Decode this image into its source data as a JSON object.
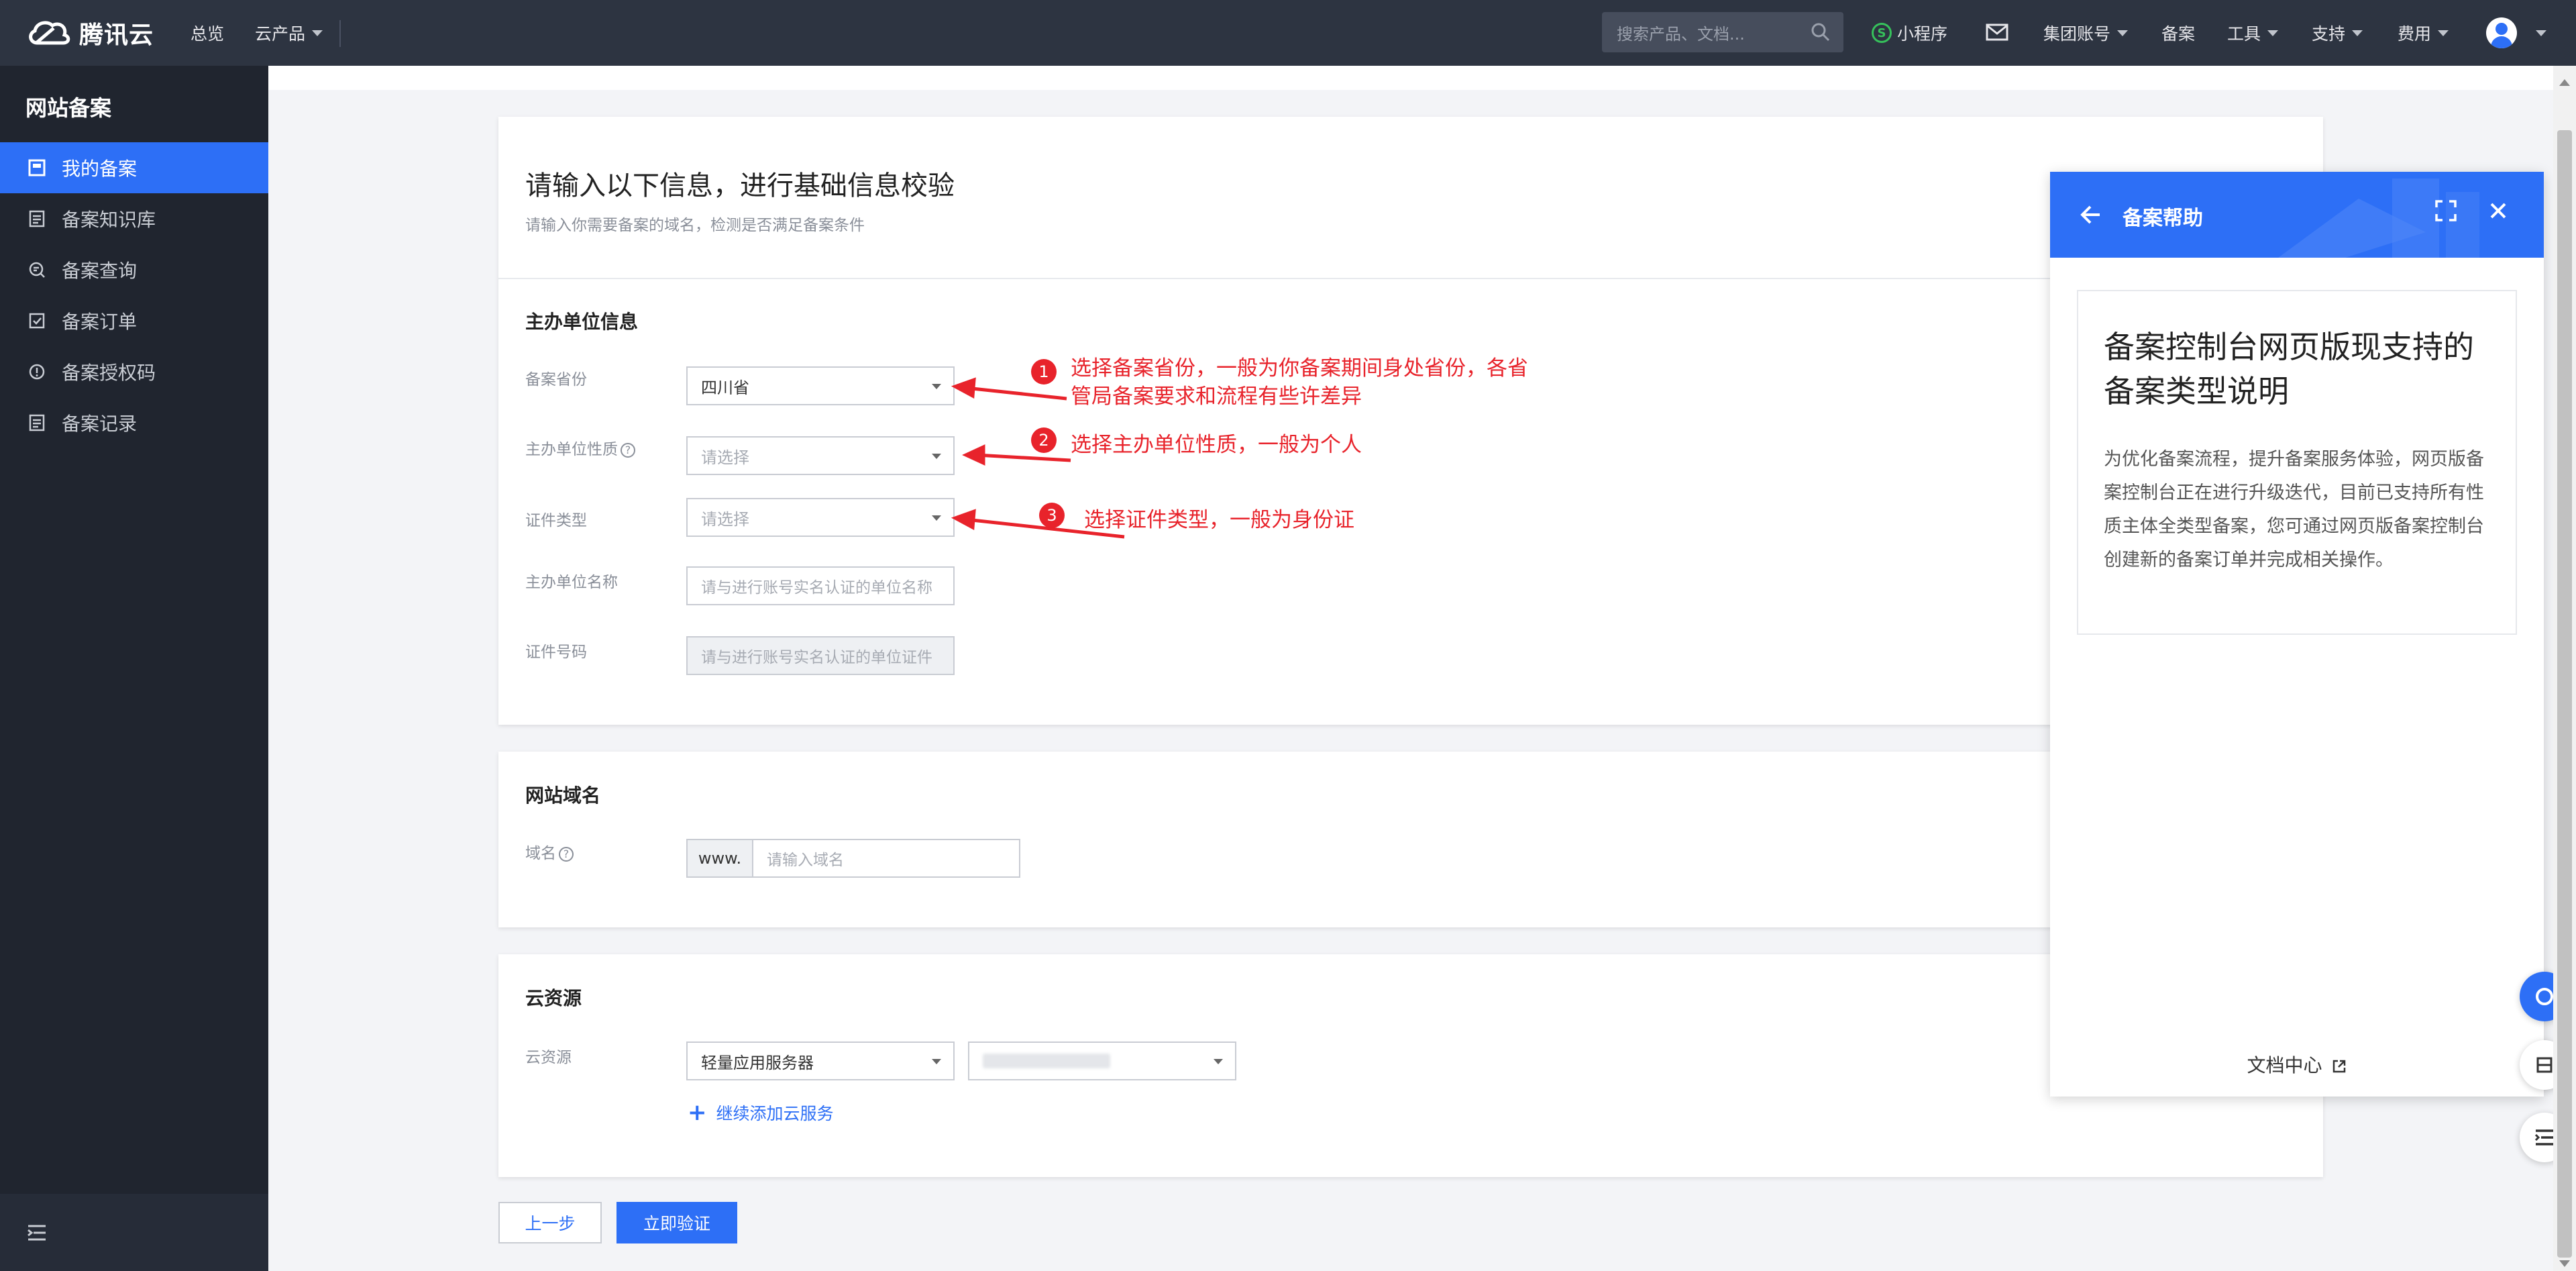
{
  "topbar": {
    "brand": "腾讯云",
    "nav": [
      "总览",
      "云产品"
    ],
    "search_placeholder": "搜索产品、文档...",
    "mini_program": "小程序",
    "right_nav": [
      "集团账号",
      "备案",
      "工具",
      "支持",
      "费用"
    ]
  },
  "sidebar": {
    "title": "网站备案",
    "items": [
      {
        "label": "我的备案",
        "icon": "page-icon",
        "active": true
      },
      {
        "label": "备案知识库",
        "icon": "document-icon"
      },
      {
        "label": "备案查询",
        "icon": "search-doc-icon"
      },
      {
        "label": "备案订单",
        "icon": "checkbox-icon"
      },
      {
        "label": "备案授权码",
        "icon": "key-circle-icon"
      },
      {
        "label": "备案记录",
        "icon": "list-doc-icon"
      }
    ]
  },
  "main": {
    "heading": "请输入以下信息，进行基础信息校验",
    "subheading": "请输入你需要备案的域名，检测是否满足备案条件",
    "sponsor": {
      "title": "主办单位信息",
      "province_label": "备案省份",
      "province_value": "四川省",
      "nature_label": "主办单位性质",
      "nature_placeholder": "请选择",
      "cert_type_label": "证件类型",
      "cert_type_placeholder": "请选择",
      "name_label": "主办单位名称",
      "name_placeholder": "请与进行账号实名认证的单位名称",
      "cert_no_label": "证件号码",
      "cert_no_placeholder": "请与进行账号实名认证的单位证件"
    },
    "domain": {
      "title": "网站域名",
      "label": "域名",
      "prefix": "www.",
      "placeholder": "请输入域名"
    },
    "cloud": {
      "title": "云资源",
      "label": "云资源",
      "product_value": "轻量应用服务器",
      "add_link": "继续添加云服务"
    },
    "buttons": {
      "prev": "上一步",
      "verify": "立即验证"
    }
  },
  "annotations": [
    {
      "num": "1",
      "text_line1": "选择备案省份，一般为你备案期间身处省份，各省",
      "text_line2": "管局备案要求和流程有些许差异"
    },
    {
      "num": "2",
      "text_line1": "选择主办单位性质，一般为个人"
    },
    {
      "num": "3",
      "text_line1": "选择证件类型，一般为身份证"
    }
  ],
  "help": {
    "title": "备案帮助",
    "article_title": "备案控制台网页版现支持的备案类型说明",
    "article_body": "为优化备案流程，提升备案服务体验，网页版备案控制台正在进行升级迭代，目前已支持所有性质主体全类型备案，您可通过网页版备案控制台创建新的备案订单并完成相关操作。",
    "doc_center": "文档中心"
  },
  "colors": {
    "accent": "#2d6ff6",
    "topbar": "#2d3441",
    "sidebar": "#20252f",
    "annotation": "#e8232b"
  }
}
